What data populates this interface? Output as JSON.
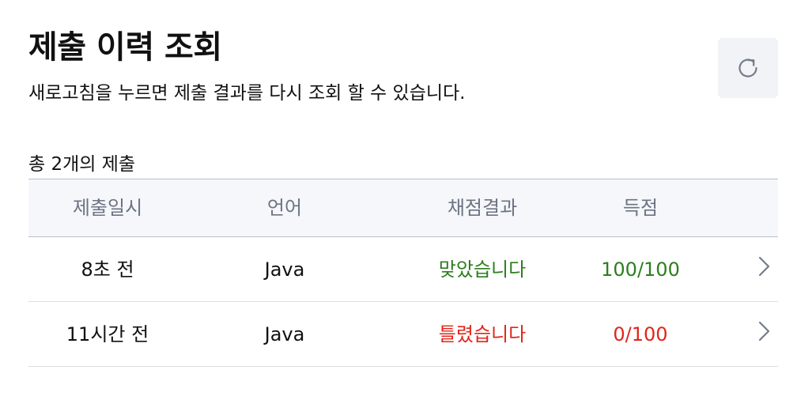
{
  "header": {
    "title": "제출 이력 조회",
    "subtitle": "새로고침을 누르면 제출 결과를 다시 조회 할 수 있습니다.",
    "refresh_icon": "refresh-icon"
  },
  "summary": {
    "count_label": "총 2개의 제출"
  },
  "table": {
    "columns": [
      "제출일시",
      "언어",
      "채점결과",
      "득점"
    ],
    "rows": [
      {
        "time": "8초 전",
        "language": "Java",
        "result": "맞았습니다",
        "score": "100/100",
        "status_color": "#2e7d1e"
      },
      {
        "time": "11시간 전",
        "language": "Java",
        "result": "틀렸습니다",
        "score": "0/100",
        "status_color": "#e0261b"
      }
    ]
  },
  "colors": {
    "accepted": "#2e7d1e",
    "rejected": "#e0261b",
    "header_bg": "#f5f7fa",
    "button_bg": "#f1f3f6",
    "muted_text": "#6c7383"
  }
}
